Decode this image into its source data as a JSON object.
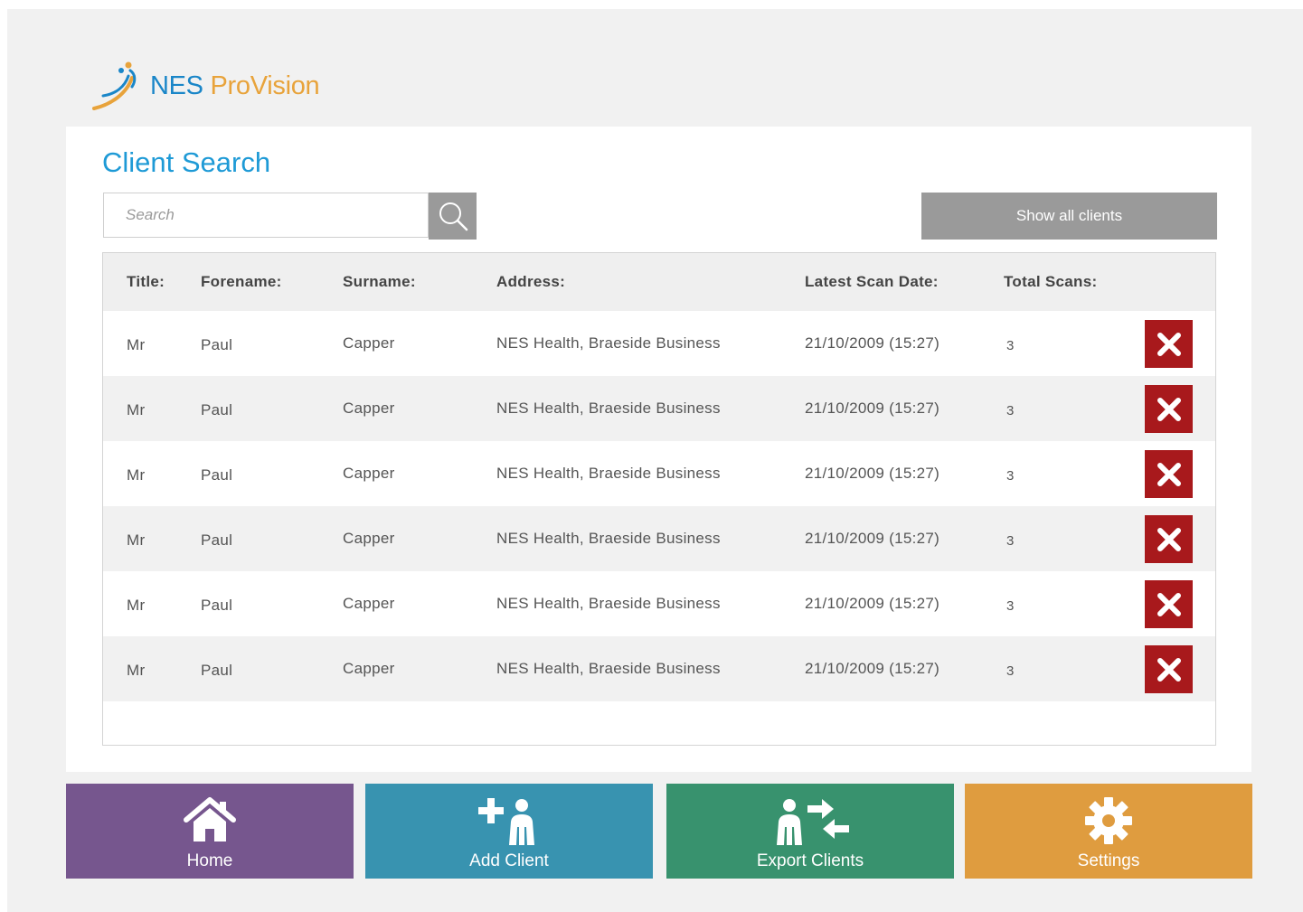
{
  "brand": {
    "name_part1": "NES",
    "name_part2": "ProVision"
  },
  "page": {
    "title": "Client Search"
  },
  "search": {
    "placeholder": "Search"
  },
  "show_all_label": "Show all clients",
  "table": {
    "headers": [
      "Title:",
      "Forename:",
      "Surname:",
      "Address:",
      "Latest Scan Date:",
      "Total Scans:"
    ],
    "rows": [
      {
        "title": "Mr",
        "forename": "Paul",
        "surname": "Capper",
        "address": "NES Health, Braeside Business",
        "latest_scan": "21/10/2009 (15:27)",
        "total_scans": "3"
      },
      {
        "title": "Mr",
        "forename": "Paul",
        "surname": "Capper",
        "address": "NES Health, Braeside Business",
        "latest_scan": "21/10/2009 (15:27)",
        "total_scans": "3"
      },
      {
        "title": "Mr",
        "forename": "Paul",
        "surname": "Capper",
        "address": "NES Health, Braeside Business",
        "latest_scan": "21/10/2009 (15:27)",
        "total_scans": "3"
      },
      {
        "title": "Mr",
        "forename": "Paul",
        "surname": "Capper",
        "address": "NES Health, Braeside Business",
        "latest_scan": "21/10/2009 (15:27)",
        "total_scans": "3"
      },
      {
        "title": "Mr",
        "forename": "Paul",
        "surname": "Capper",
        "address": "NES Health, Braeside Business",
        "latest_scan": "21/10/2009 (15:27)",
        "total_scans": "3"
      },
      {
        "title": "Mr",
        "forename": "Paul",
        "surname": "Capper",
        "address": "NES Health, Braeside Business",
        "latest_scan": "21/10/2009 (15:27)",
        "total_scans": "3"
      }
    ]
  },
  "nav": {
    "home": "Home",
    "add_client": "Add Client",
    "export_clients": "Export Clients",
    "settings": "Settings"
  },
  "colors": {
    "title_blue": "#1e9ad6",
    "delete_red": "#a8191c",
    "home_purple": "#76568e",
    "add_teal": "#3893b0",
    "export_green": "#38926e",
    "settings_orange": "#df9c3f",
    "neutral_gray": "#9a9a9a"
  },
  "icons": [
    "logo-swoosh-icon",
    "search-icon",
    "delete-x-icon",
    "home-icon",
    "add-person-icon",
    "export-person-icon",
    "gear-icon"
  ]
}
